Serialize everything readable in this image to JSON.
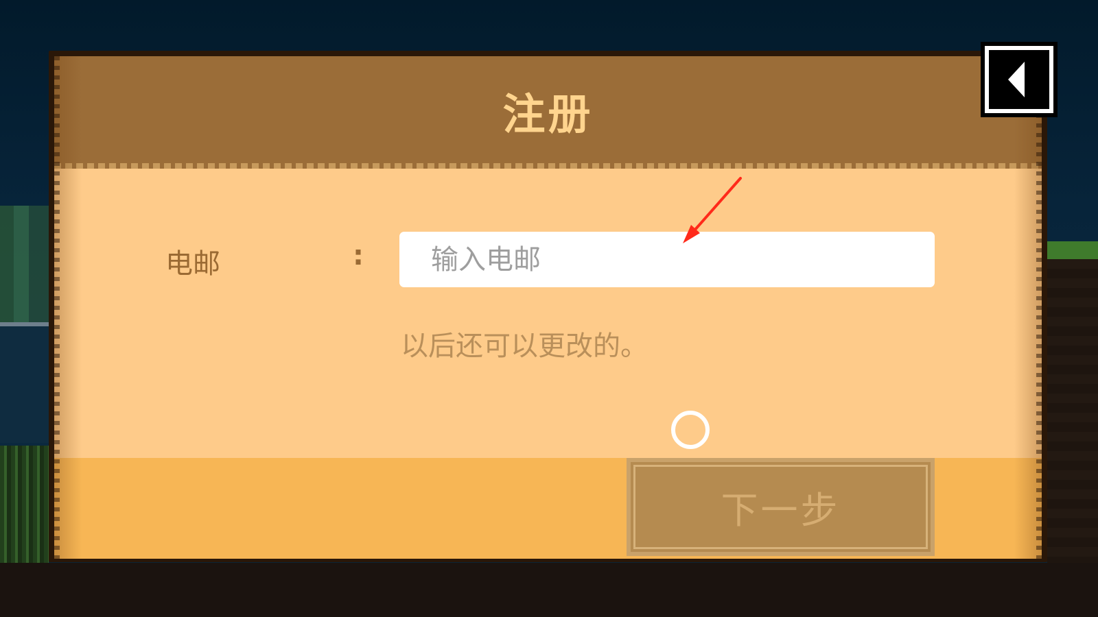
{
  "dialog": {
    "title": "注册"
  },
  "form": {
    "email_label": "电邮",
    "colon": ":",
    "email_placeholder": "输入电邮",
    "email_value": "",
    "hint": "以后还可以更改的。"
  },
  "footer": {
    "next_label": "下一步"
  },
  "icons": {
    "back": "back-triangle-icon",
    "loading": "loading-ring-icon",
    "annotation": "red-arrow-icon"
  },
  "colors": {
    "header": "#9b6d38",
    "body": "#fecb8a",
    "footer": "#f7b655",
    "title_text": "#ffd48e",
    "label_text": "#9a6a33",
    "hint_text": "#b98f5a",
    "next_button": "#b58b50",
    "annotation_arrow": "#ff2a1a"
  }
}
